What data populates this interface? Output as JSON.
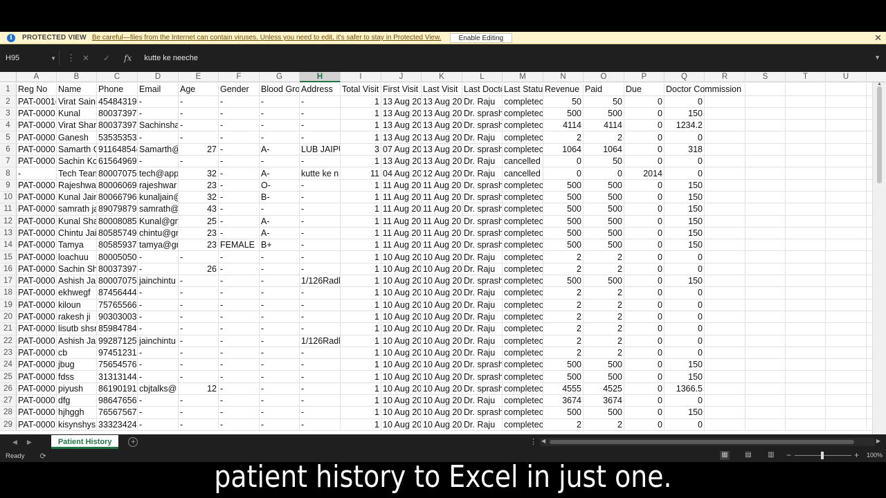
{
  "protected_view": {
    "title": "PROTECTED VIEW",
    "message": "Be careful—files from the Internet can contain viruses. Unless you need to edit, it's safer to stay in Protected View.",
    "button": "Enable Editing"
  },
  "formula_bar": {
    "name_box": "H95",
    "formula": "kutte ke neeche",
    "fx_label": "fx"
  },
  "columns": [
    "A",
    "B",
    "C",
    "D",
    "E",
    "F",
    "G",
    "H",
    "I",
    "J",
    "K",
    "L",
    "M",
    "N",
    "O",
    "P",
    "Q",
    "R",
    "S",
    "T",
    "U"
  ],
  "selected_column": "H",
  "rows": [
    {
      "n": "1",
      "c": [
        "Reg No",
        "Name",
        "Phone",
        "Email",
        "Age",
        "Gender",
        "Blood Gro",
        "Address",
        "Total Visit",
        "First Visit",
        "Last Visit",
        "Last Doctc",
        "Last Statu",
        "Revenue",
        "Paid",
        "Due",
        "Doctor Commission"
      ]
    },
    {
      "n": "2",
      "c": [
        "PAT-0001(",
        "Virat Saini",
        "45484319(",
        "-",
        "-",
        "-",
        "-",
        "-",
        "1",
        "13 Aug 20",
        "13 Aug 20",
        "Dr. Raju",
        "completec",
        "50",
        "50",
        "0",
        "0"
      ]
    },
    {
      "n": "3",
      "c": [
        "PAT-0000",
        "Kunal",
        "80037397",
        "-",
        "-",
        "-",
        "-",
        "-",
        "1",
        "13 Aug 20",
        "13 Aug 20",
        "Dr. sprash",
        "completec",
        "500",
        "500",
        "0",
        "150"
      ]
    },
    {
      "n": "4",
      "c": [
        "PAT-0000",
        "Virat Shar",
        "80037397",
        "Sachinsha",
        "-",
        "-",
        "-",
        "-",
        "1",
        "13 Aug 20",
        "13 Aug 20",
        "Dr. sprash",
        "completec",
        "4114",
        "4114",
        "0",
        "1234.2"
      ]
    },
    {
      "n": "5",
      "c": [
        "PAT-0000",
        "Ganesh",
        "53535353",
        "-",
        "-",
        "-",
        "-",
        "-",
        "1",
        "13 Aug 20",
        "13 Aug 20",
        "Dr. Raju",
        "completec",
        "2",
        "2",
        "0",
        "0"
      ]
    },
    {
      "n": "6",
      "c": [
        "PAT-0000",
        "Samarth G",
        "91164854(",
        "Samarth@",
        "27",
        "-",
        "A-",
        "LUB JAIPU",
        "3",
        "07 Aug 20",
        "13 Aug 20",
        "Dr. sprash",
        "completec",
        "1064",
        "1064",
        "0",
        "318"
      ]
    },
    {
      "n": "7",
      "c": [
        "PAT-0000",
        "Sachin Kol",
        "61564969",
        "-",
        "-",
        "-",
        "-",
        "-",
        "1",
        "13 Aug 20",
        "13 Aug 20",
        "Dr. Raju",
        "cancelled",
        "0",
        "50",
        "0",
        "0"
      ]
    },
    {
      "n": "8",
      "c": [
        "-",
        "Tech Tean",
        "80007075(",
        "tech@app",
        "32",
        "-",
        "A-",
        "kutte ke n",
        "11",
        "04 Aug 20",
        "12 Aug 20",
        "Dr. Raju",
        "cancelled",
        "0",
        "0",
        "2014",
        "0"
      ]
    },
    {
      "n": "9",
      "c": [
        "PAT-0000",
        "Rajeshwar",
        "80006069(",
        "rajeshwar",
        "23",
        "-",
        "O-",
        "-",
        "1",
        "11 Aug 20",
        "11 Aug 20",
        "Dr. sprash",
        "completec",
        "500",
        "500",
        "0",
        "150"
      ]
    },
    {
      "n": "10",
      "c": [
        "PAT-0000",
        "Kunal Jain",
        "80066796",
        "kunaljain@",
        "32",
        "-",
        "B-",
        "-",
        "1",
        "11 Aug 20",
        "11 Aug 20",
        "Dr. sprash",
        "completec",
        "500",
        "500",
        "0",
        "150"
      ]
    },
    {
      "n": "11",
      "c": [
        "PAT-0000",
        "samrath ja",
        "89079879(",
        "samrath@",
        "43",
        "-",
        "-",
        "-",
        "1",
        "11 Aug 20",
        "11 Aug 20",
        "Dr. sprash",
        "completec",
        "500",
        "500",
        "0",
        "150"
      ]
    },
    {
      "n": "12",
      "c": [
        "PAT-0000",
        "Kunal Sha",
        "80008085(",
        "Kunal@gn",
        "25",
        "-",
        "A-",
        "-",
        "1",
        "11 Aug 20",
        "11 Aug 20",
        "Dr. sprash",
        "completec",
        "500",
        "500",
        "0",
        "150"
      ]
    },
    {
      "n": "13",
      "c": [
        "PAT-0000",
        "Chintu Jai",
        "80585749",
        "chintu@gr",
        "23",
        "-",
        "A-",
        "-",
        "1",
        "11 Aug 20",
        "11 Aug 20",
        "Dr. sprash",
        "completec",
        "500",
        "500",
        "0",
        "150"
      ]
    },
    {
      "n": "14",
      "c": [
        "PAT-0000",
        "Tamya",
        "80585937",
        "tamya@gr",
        "23",
        "FEMALE",
        "B+",
        "-",
        "1",
        "11 Aug 20",
        "11 Aug 20",
        "Dr. sprash",
        "completec",
        "500",
        "500",
        "0",
        "150"
      ]
    },
    {
      "n": "15",
      "c": [
        "PAT-0000",
        "loachuu",
        "80005050",
        "-",
        "-",
        "-",
        "-",
        "-",
        "1",
        "10 Aug 20",
        "10 Aug 20",
        "Dr. Raju",
        "completec",
        "2",
        "2",
        "0",
        "0"
      ]
    },
    {
      "n": "16",
      "c": [
        "PAT-0000",
        "Sachin Sh",
        "80037397",
        "-",
        "26",
        "-",
        "-",
        "-",
        "1",
        "10 Aug 20",
        "10 Aug 20",
        "Dr. Raju",
        "completec",
        "2",
        "2",
        "0",
        "0"
      ]
    },
    {
      "n": "17",
      "c": [
        "PAT-0000",
        "Ashish Jai",
        "80007075(",
        "jainchintu",
        "-",
        "-",
        "-",
        "1/126Radl",
        "1",
        "10 Aug 20",
        "10 Aug 20",
        "Dr. sprash",
        "completec",
        "500",
        "500",
        "0",
        "150"
      ]
    },
    {
      "n": "18",
      "c": [
        "PAT-0000",
        "ekhwegf",
        "87456444",
        "-",
        "-",
        "-",
        "-",
        "-",
        "1",
        "10 Aug 20",
        "10 Aug 20",
        "Dr. Raju",
        "completec",
        "2",
        "2",
        "0",
        "0"
      ]
    },
    {
      "n": "19",
      "c": [
        "PAT-0000",
        "kiloun",
        "75765566",
        "-",
        "-",
        "-",
        "-",
        "-",
        "1",
        "10 Aug 20",
        "10 Aug 20",
        "Dr. Raju",
        "completec",
        "2",
        "2",
        "0",
        "0"
      ]
    },
    {
      "n": "20",
      "c": [
        "PAT-0000",
        "rakesh ji",
        "90303003",
        "-",
        "-",
        "-",
        "-",
        "-",
        "1",
        "10 Aug 20",
        "10 Aug 20",
        "Dr. Raju",
        "completec",
        "2",
        "2",
        "0",
        "0"
      ]
    },
    {
      "n": "21",
      "c": [
        "PAT-0000",
        "lisutb shsr",
        "85984784",
        "-",
        "-",
        "-",
        "-",
        "-",
        "1",
        "10 Aug 20",
        "10 Aug 20",
        "Dr. Raju",
        "completec",
        "2",
        "2",
        "0",
        "0"
      ]
    },
    {
      "n": "22",
      "c": [
        "PAT-0000",
        "Ashish Jai",
        "99287125(",
        "jainchintu",
        "-",
        "-",
        "-",
        "1/126Radl",
        "1",
        "10 Aug 20",
        "10 Aug 20",
        "Dr. Raju",
        "completec",
        "2",
        "2",
        "0",
        "0"
      ]
    },
    {
      "n": "23",
      "c": [
        "PAT-0000",
        "cb",
        "97451231",
        "-",
        "-",
        "-",
        "-",
        "-",
        "1",
        "10 Aug 20",
        "10 Aug 20",
        "Dr. Raju",
        "completec",
        "2",
        "2",
        "0",
        "0"
      ]
    },
    {
      "n": "24",
      "c": [
        "PAT-0000",
        "jbug",
        "75654576",
        "-",
        "-",
        "-",
        "-",
        "-",
        "1",
        "10 Aug 20",
        "10 Aug 20",
        "Dr. sprash",
        "completec",
        "500",
        "500",
        "0",
        "150"
      ]
    },
    {
      "n": "25",
      "c": [
        "PAT-0000",
        "fdss",
        "31313144",
        "-",
        "-",
        "-",
        "-",
        "-",
        "1",
        "10 Aug 20",
        "10 Aug 20",
        "Dr. sprash",
        "completec",
        "500",
        "500",
        "0",
        "150"
      ]
    },
    {
      "n": "26",
      "c": [
        "PAT-0000",
        "piyush",
        "86190191",
        "cbjtalks@",
        "12",
        "-",
        "-",
        "-",
        "1",
        "10 Aug 20",
        "10 Aug 20",
        "Dr. sprash",
        "completec",
        "4555",
        "4525",
        "0",
        "1366.5"
      ]
    },
    {
      "n": "27",
      "c": [
        "PAT-0000",
        "dfg",
        "98647656",
        "-",
        "-",
        "-",
        "-",
        "-",
        "1",
        "10 Aug 20",
        "10 Aug 20",
        "Dr. Raju",
        "completec",
        "3674",
        "3674",
        "0",
        "0"
      ]
    },
    {
      "n": "28",
      "c": [
        "PAT-0000",
        "hjhggh",
        "76567567",
        "-",
        "-",
        "-",
        "-",
        "-",
        "1",
        "10 Aug 20",
        "10 Aug 20",
        "Dr. sprash",
        "completec",
        "500",
        "500",
        "0",
        "150"
      ]
    },
    {
      "n": "29",
      "c": [
        "PAT-0000",
        "kisynshys",
        "33323424",
        "-",
        "-",
        "-",
        "-",
        "-",
        "1",
        "10 Aug 20",
        "10 Aug 20",
        "Dr. Raju",
        "completec",
        "2",
        "2",
        "0",
        "0"
      ]
    }
  ],
  "sheet_tab": "Patient History",
  "status": {
    "ready": "Ready",
    "zoom": "100%"
  },
  "caption": "patient history to Excel in just one."
}
